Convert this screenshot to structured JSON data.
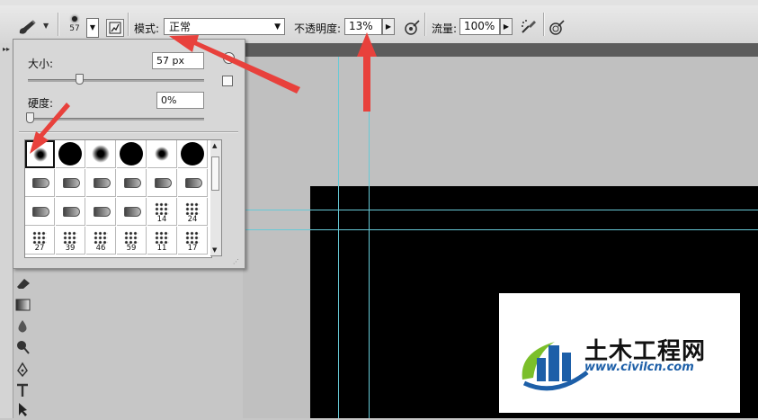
{
  "options_bar": {
    "brush_size_thumb": "57",
    "mode_label": "模式:",
    "mode_value": "正常",
    "opacity_label": "不透明度:",
    "opacity_value": "13%",
    "flow_label": "流量:",
    "flow_value": "100%"
  },
  "brush_panel": {
    "size_label": "大小:",
    "size_value": "57 px",
    "size_fraction": 0.29,
    "hardness_label": "硬度:",
    "hardness_value": "0%",
    "hardness_fraction": 0.0,
    "presets": [
      {
        "kind": "soft",
        "d": 16,
        "label": ""
      },
      {
        "kind": "hard",
        "d": 26,
        "label": ""
      },
      {
        "kind": "soft",
        "d": 20,
        "label": ""
      },
      {
        "kind": "hard",
        "d": 26,
        "label": ""
      },
      {
        "kind": "soft",
        "d": 16,
        "label": ""
      },
      {
        "kind": "hard",
        "d": 26,
        "label": ""
      },
      {
        "kind": "tip",
        "label": ""
      },
      {
        "kind": "tip",
        "label": ""
      },
      {
        "kind": "tip",
        "label": ""
      },
      {
        "kind": "tip",
        "label": ""
      },
      {
        "kind": "tip",
        "label": ""
      },
      {
        "kind": "tip",
        "label": ""
      },
      {
        "kind": "tip",
        "label": ""
      },
      {
        "kind": "tip",
        "label": ""
      },
      {
        "kind": "tip",
        "label": ""
      },
      {
        "kind": "tip",
        "label": ""
      },
      {
        "kind": "scatter",
        "label": "14"
      },
      {
        "kind": "scatter",
        "label": "24"
      },
      {
        "kind": "scatter",
        "label": "27"
      },
      {
        "kind": "scatter",
        "label": "39"
      },
      {
        "kind": "scatter",
        "label": "46"
      },
      {
        "kind": "scatter",
        "label": "59"
      },
      {
        "kind": "scatter",
        "label": "11"
      },
      {
        "kind": "scatter",
        "label": "17"
      }
    ],
    "selected_index": 0
  },
  "watermark": {
    "name": "土木工程网",
    "url": "www.civilcn.com"
  },
  "colors": {
    "annotation_arrow": "#e8413c",
    "guide": "#67c9d6",
    "canvas": "#000000",
    "logo_blue": "#1d5fa8",
    "logo_green": "#7bbf2a"
  },
  "icons": {
    "tool_preset": "brush-icon",
    "toggle_brush_panel": "brush-panel-toggle-icon",
    "airbrush_opacity": "tablet-pressure-opacity-icon",
    "airbrush": "airbrush-icon",
    "tablet_size": "tablet-pressure-size-icon"
  }
}
